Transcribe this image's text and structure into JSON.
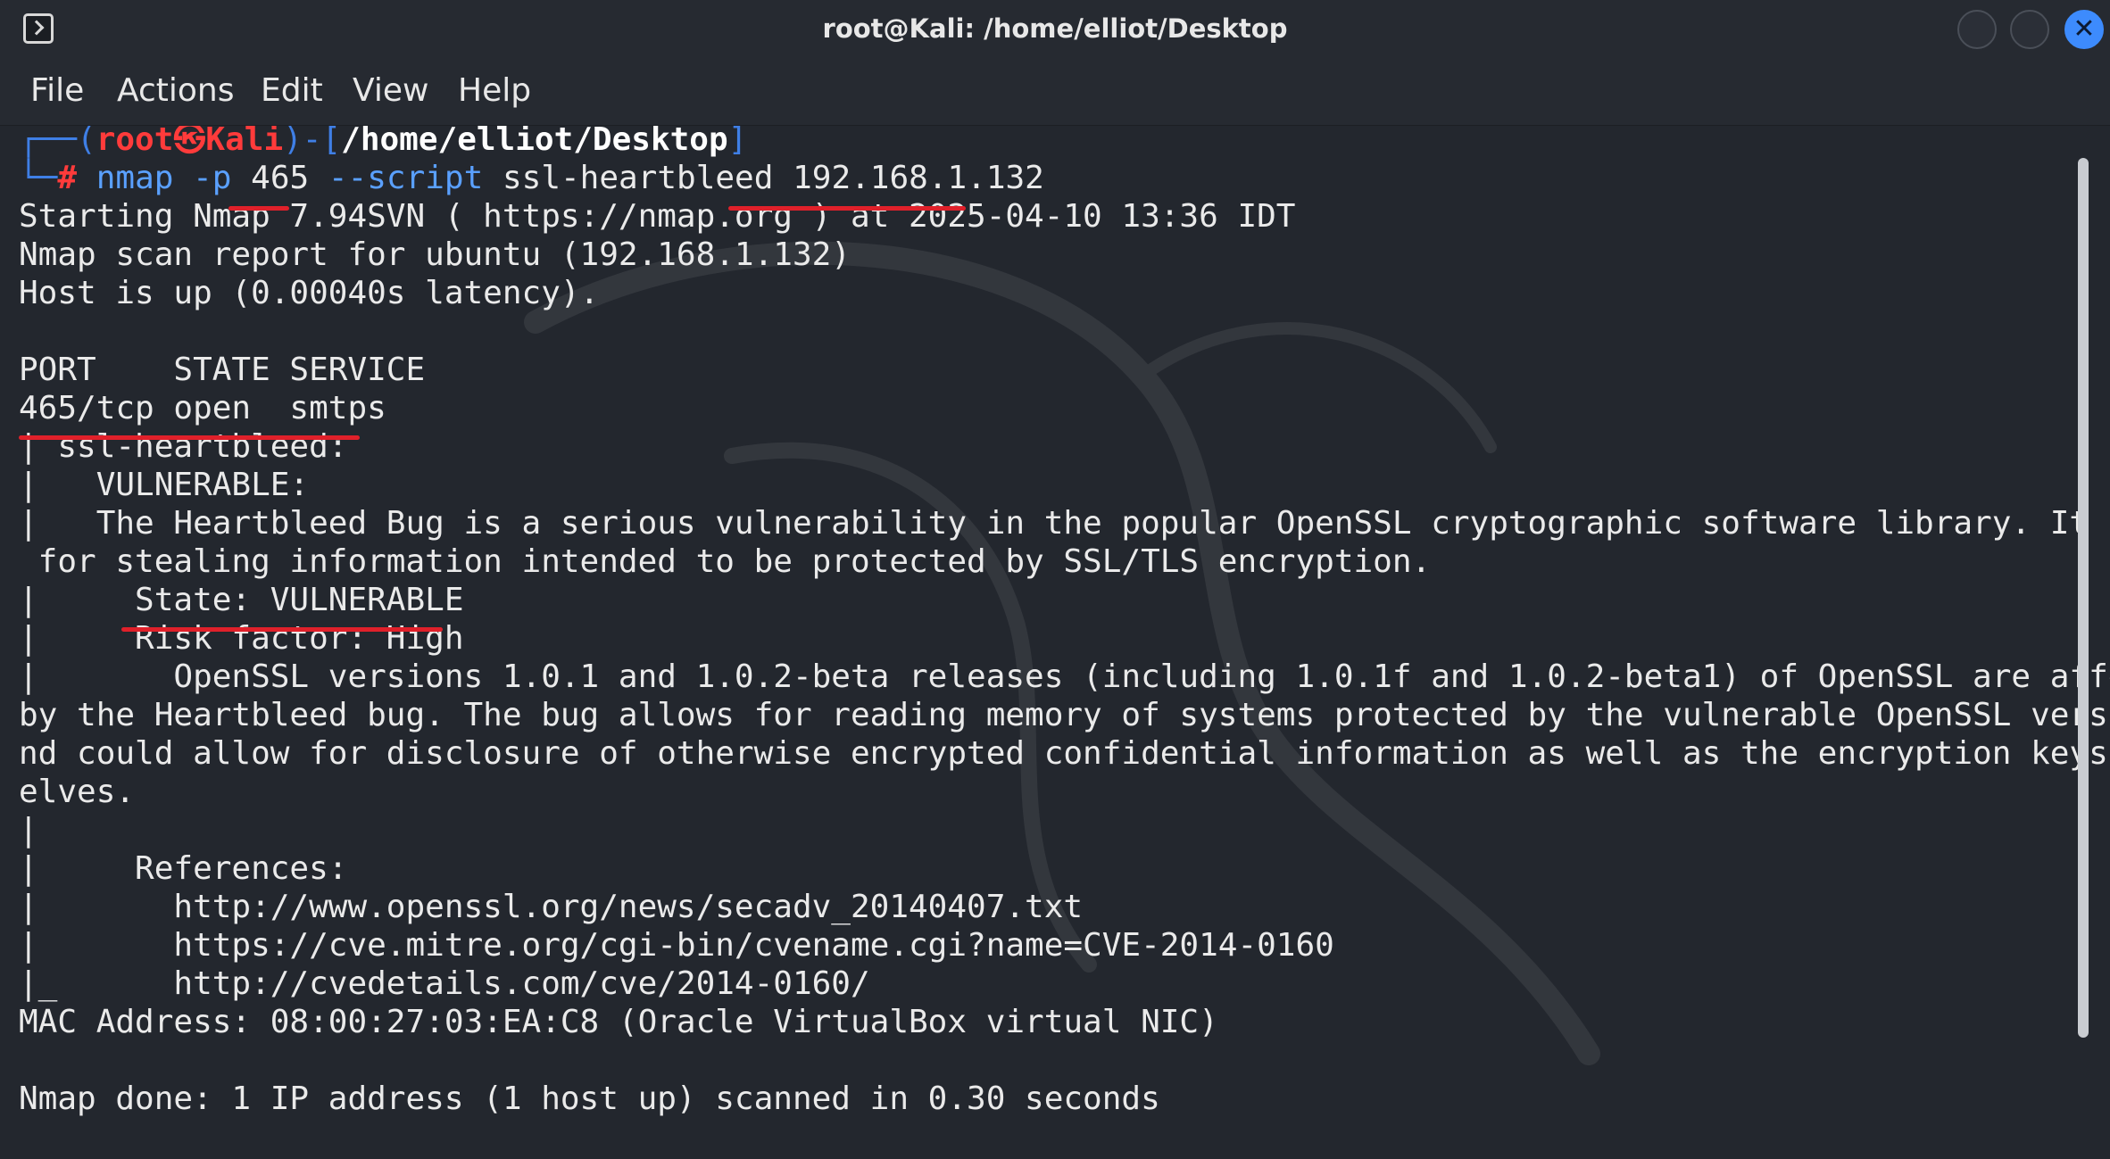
{
  "window": {
    "title": "root@Kali: /home/elliot/Desktop"
  },
  "menu": {
    "items": [
      "File",
      "Actions",
      "Edit",
      "View",
      "Help"
    ]
  },
  "prompt": {
    "box_top_left": "┌──(",
    "user": "root",
    "skull": "㉿",
    "host": "Kali",
    "mid": ")-[",
    "path": "/home/elliot/Desktop",
    "close": "]",
    "box_bottom_left": "└─",
    "hash": "#",
    "command_nmap": "nmap",
    "command_p": "-p",
    "command_port": "465",
    "command_script_flag": "--script",
    "command_script_name": "ssl-heartbleed",
    "command_target": "192.168.1.132"
  },
  "output": {
    "lines": [
      "Starting Nmap 7.94SVN ( https://nmap.org ) at 2025-04-10 13:36 IDT",
      "Nmap scan report for ubuntu (192.168.1.132)",
      "Host is up (0.00040s latency).",
      "",
      "PORT    STATE SERVICE",
      "465/tcp open  smtps",
      "| ssl-heartbleed:",
      "|   VULNERABLE:",
      "|   The Heartbleed Bug is a serious vulnerability in the popular OpenSSL cryptographic software library. It allows",
      " for stealing information intended to be protected by SSL/TLS encryption.",
      "|     State: VULNERABLE",
      "|     Risk factor: High",
      "|       OpenSSL versions 1.0.1 and 1.0.2-beta releases (including 1.0.1f and 1.0.2-beta1) of OpenSSL are affected",
      "by the Heartbleed bug. The bug allows for reading memory of systems protected by the vulnerable OpenSSL versions a",
      "nd could allow for disclosure of otherwise encrypted confidential information as well as the encryption keys thems",
      "elves.",
      "|",
      "|     References:",
      "|       http://www.openssl.org/news/secadv_20140407.txt",
      "|       https://cve.mitre.org/cgi-bin/cvename.cgi?name=CVE-2014-0160",
      "|_      http://cvedetails.com/cve/2014-0160/",
      "MAC Address: 08:00:27:03:EA:C8 (Oracle VirtualBox virtual NIC)",
      "",
      "Nmap done: 1 IP address (1 host up) scanned in 0.30 seconds"
    ]
  },
  "colors": {
    "background": "#23272e",
    "prompt_blue": "#3f7fe6",
    "prompt_red": "#ff3b3b",
    "annotation_red": "#e0202a",
    "close_button": "#3d8bfd"
  }
}
